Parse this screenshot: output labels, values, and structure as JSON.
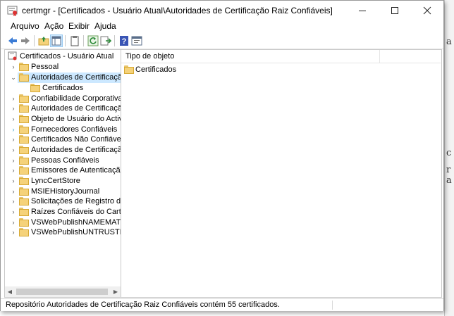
{
  "window": {
    "title": "certmgr - [Certificados - Usuário Atual\\Autoridades de Certificação Raiz Confiáveis]",
    "controls": [
      "minimize",
      "maximize",
      "close"
    ]
  },
  "menu": {
    "items": [
      "Arquivo",
      "Ação",
      "Exibir",
      "Ajuda"
    ]
  },
  "toolbar": {
    "buttons": [
      "back-arrow-icon",
      "forward-arrow-icon",
      "up-folder-icon",
      "show-hide-tree-icon",
      "clipboard-icon",
      "refresh-icon",
      "export-list-icon",
      "help-icon",
      "properties-icon"
    ]
  },
  "tree": {
    "root": "Certificados - Usuário Atual",
    "items": [
      {
        "label": "Pessoal",
        "expanded": false
      },
      {
        "label": "Autoridades de Certificação R",
        "expanded": true,
        "selected": true
      },
      {
        "label": "Certificados",
        "child": true
      },
      {
        "label": "Confiabilidade Corporativa",
        "expanded": false
      },
      {
        "label": "Autoridades de Certificação I",
        "expanded": false
      },
      {
        "label": "Objeto de Usuário do Active I",
        "expanded": false
      },
      {
        "label": "Fornecedores Confiáveis",
        "expanded": false
      },
      {
        "label": "Certificados Não Confiáveis",
        "expanded": false
      },
      {
        "label": "Autoridades de Certificação F",
        "expanded": false
      },
      {
        "label": "Pessoas Confiáveis",
        "expanded": false
      },
      {
        "label": "Emissores de Autenticação d",
        "expanded": false
      },
      {
        "label": "LyncCertStore",
        "expanded": false
      },
      {
        "label": "MSIEHistoryJournal",
        "expanded": false
      },
      {
        "label": "Solicitações de Registro de Ce",
        "expanded": false
      },
      {
        "label": "Raízes Confiáveis do Cartão Ir",
        "expanded": false
      },
      {
        "label": "VSWebPublishNAMEMATCHC",
        "expanded": false
      },
      {
        "label": "VSWebPublishUNTRUSTEDRC",
        "expanded": false
      }
    ]
  },
  "list": {
    "column_header": "Tipo de objeto",
    "rows": [
      "Certificados"
    ]
  },
  "status": {
    "text": "Repositório Autoridades de Certificação Raiz Confiáveis contém 55 certificados."
  },
  "colors": {
    "selection": "#cce8ff",
    "folder": "#f5d27a",
    "accent_blue": "#3a7bd5"
  }
}
